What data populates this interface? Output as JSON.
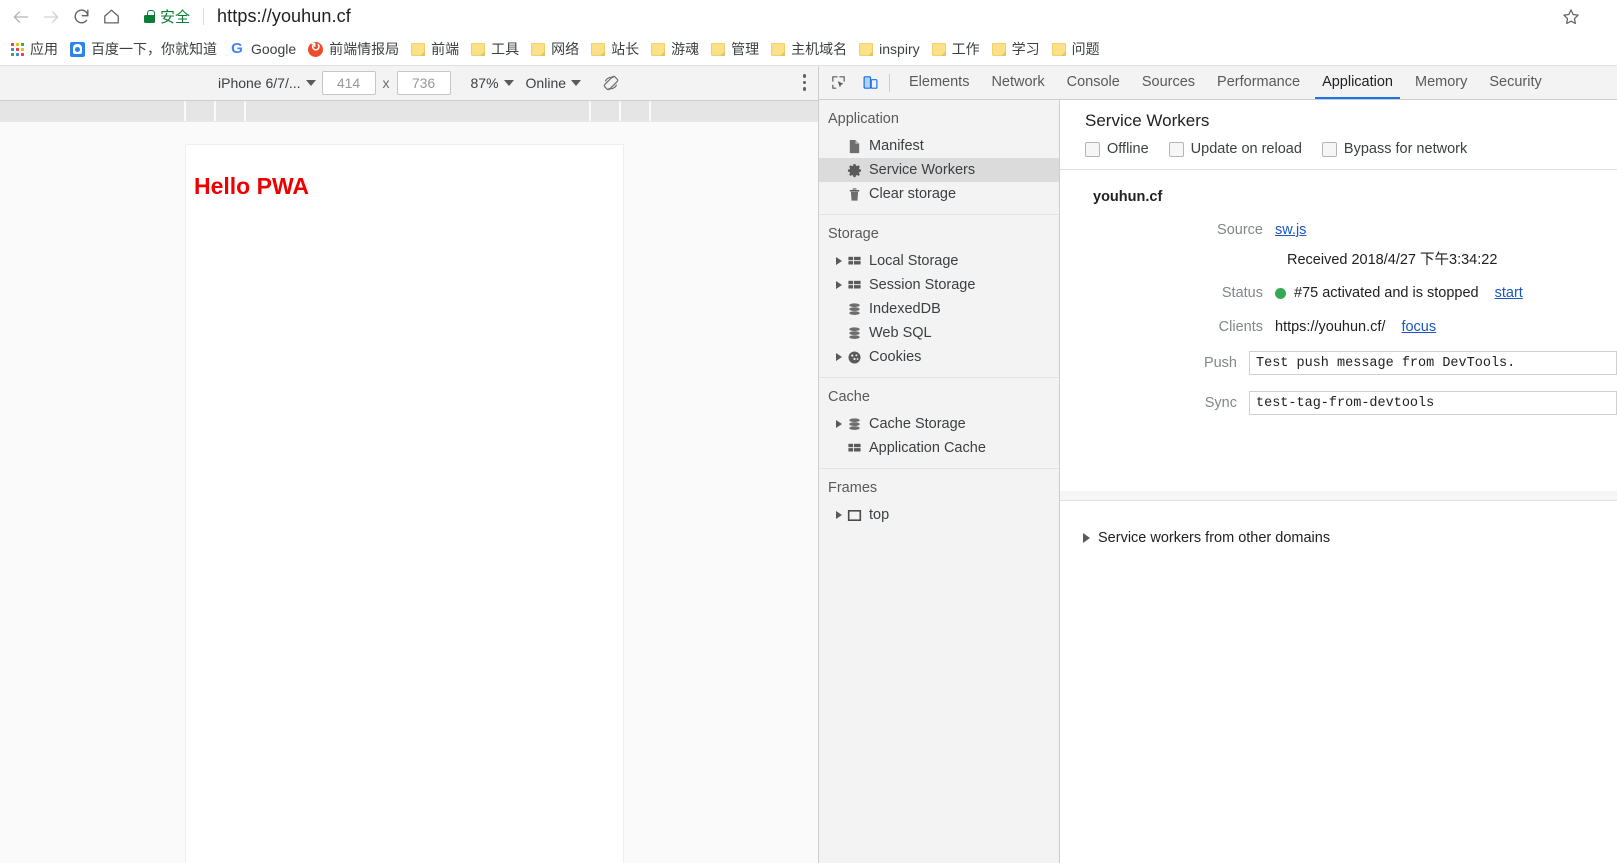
{
  "browser": {
    "nav": {
      "back": "back-arrow",
      "forward": "forward-arrow",
      "reload": "reload",
      "home": "home"
    },
    "omnibox": {
      "secure_label": "安全",
      "url": "https://youhun.cf",
      "star": "bookmark-star"
    },
    "bookmarks": [
      {
        "type": "apps",
        "label": "应用"
      },
      {
        "type": "baidu",
        "label": "百度一下，你就知道"
      },
      {
        "type": "google",
        "label": "Google"
      },
      {
        "type": "orange",
        "label": "前端情报局"
      },
      {
        "type": "folder",
        "label": "前端"
      },
      {
        "type": "folder",
        "label": "工具"
      },
      {
        "type": "folder",
        "label": "网络"
      },
      {
        "type": "folder",
        "label": "站长"
      },
      {
        "type": "folder",
        "label": "游魂"
      },
      {
        "type": "folder",
        "label": "管理"
      },
      {
        "type": "folder",
        "label": "主机域名"
      },
      {
        "type": "folder",
        "label": "inspiry"
      },
      {
        "type": "folder",
        "label": "工作"
      },
      {
        "type": "folder",
        "label": "学习"
      },
      {
        "type": "folder",
        "label": "问题"
      }
    ]
  },
  "device_toolbar": {
    "device": "iPhone 6/7/...",
    "width": "414",
    "height": "736",
    "times": "x",
    "zoom": "87%",
    "throttle": "Online",
    "rotate_icon": "rotate-device-icon",
    "more_icon": "more-options-icon"
  },
  "viewport": {
    "heading": "Hello PWA",
    "heading_color": "#ee0000"
  },
  "devtools": {
    "left_icons": {
      "inspect": "inspect-element-icon",
      "device_toggle": "toggle-device-toolbar-icon"
    },
    "tabs": [
      {
        "label": "Elements",
        "selected": false
      },
      {
        "label": "Network",
        "selected": false
      },
      {
        "label": "Console",
        "selected": false
      },
      {
        "label": "Sources",
        "selected": false
      },
      {
        "label": "Performance",
        "selected": false
      },
      {
        "label": "Application",
        "selected": true
      },
      {
        "label": "Memory",
        "selected": false
      },
      {
        "label": "Security",
        "selected": false
      }
    ],
    "sidebar": [
      {
        "header": "Application",
        "items": [
          {
            "label": "Manifest",
            "icon": "document-icon",
            "expandable": false,
            "selected": false
          },
          {
            "label": "Service Workers",
            "icon": "gear-icon",
            "expandable": false,
            "selected": true
          },
          {
            "label": "Clear storage",
            "icon": "trash-icon",
            "expandable": false,
            "selected": false
          }
        ]
      },
      {
        "header": "Storage",
        "items": [
          {
            "label": "Local Storage",
            "icon": "table-icon",
            "expandable": true,
            "selected": false
          },
          {
            "label": "Session Storage",
            "icon": "table-icon",
            "expandable": true,
            "selected": false
          },
          {
            "label": "IndexedDB",
            "icon": "database-icon",
            "expandable": false,
            "selected": false
          },
          {
            "label": "Web SQL",
            "icon": "database-icon",
            "expandable": false,
            "selected": false
          },
          {
            "label": "Cookies",
            "icon": "cookie-icon",
            "expandable": true,
            "selected": false
          }
        ]
      },
      {
        "header": "Cache",
        "items": [
          {
            "label": "Cache Storage",
            "icon": "database-icon",
            "expandable": true,
            "selected": false
          },
          {
            "label": "Application Cache",
            "icon": "table-icon",
            "expandable": false,
            "selected": false
          }
        ]
      },
      {
        "header": "Frames",
        "items": [
          {
            "label": "top",
            "icon": "frame-icon",
            "expandable": true,
            "selected": false
          }
        ]
      }
    ],
    "service_workers": {
      "title": "Service Workers",
      "checkboxes": [
        {
          "label": "Offline",
          "checked": false
        },
        {
          "label": "Update on reload",
          "checked": false
        },
        {
          "label": "Bypass for network",
          "checked": false
        }
      ],
      "origin": "youhun.cf",
      "source_label": "Source",
      "source_link": "sw.js",
      "received": "Received 2018/4/27 下午3:34:22",
      "status_label": "Status",
      "status_text": "#75 activated and is stopped",
      "status_action": "start",
      "status_color": "#34a853",
      "clients_label": "Clients",
      "clients_value": "https://youhun.cf/",
      "clients_action": "focus",
      "push_label": "Push",
      "push_value": "Test push message from DevTools.",
      "sync_label": "Sync",
      "sync_value": "test-tag-from-devtools",
      "other_domains": "Service workers from other domains"
    }
  }
}
